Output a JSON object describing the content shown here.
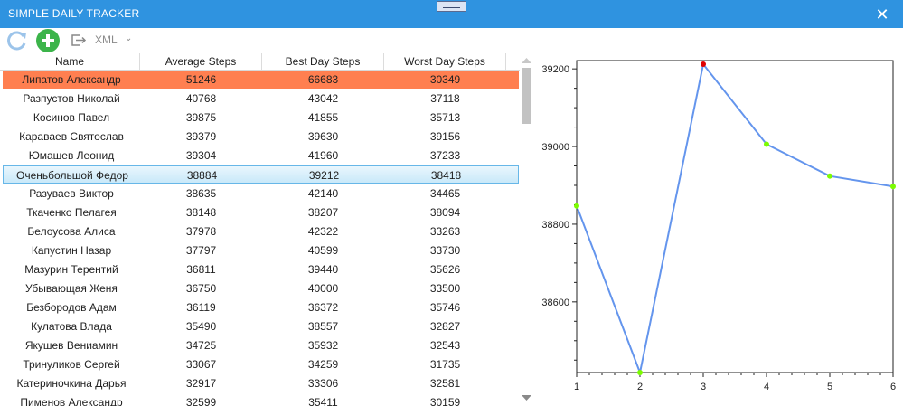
{
  "window": {
    "title": "SIMPLE DAILY TRACKER",
    "close_glyph": "✕"
  },
  "toolbar": {
    "refresh_icon": "refresh-icon",
    "add_icon": "add-icon",
    "export_icon": "export-icon",
    "format_label": "XML",
    "dropdown_glyph": "⌄"
  },
  "colors": {
    "titlebar": "#2f93e0",
    "selected_row": "#ff7f50",
    "line": "#6495ed",
    "point": "#7cfc00",
    "max_point": "#e00000"
  },
  "table": {
    "columns": [
      "Name",
      "Average Steps",
      "Best Day Steps",
      "Worst Day Steps"
    ],
    "rows": [
      [
        "Липатов Александр",
        "51246",
        "66683",
        "30349"
      ],
      [
        "Разпустов Николай",
        "40768",
        "43042",
        "37118"
      ],
      [
        "Косинов Павел",
        "39875",
        "41855",
        "35713"
      ],
      [
        "Караваев Святослав",
        "39379",
        "39630",
        "39156"
      ],
      [
        "Юмашев Леонид",
        "39304",
        "41960",
        "37233"
      ],
      [
        "Оченьбольшой Федор",
        "38884",
        "39212",
        "38418"
      ],
      [
        "Разуваев Виктор",
        "38635",
        "42140",
        "34465"
      ],
      [
        "Ткаченко Пелагея",
        "38148",
        "38207",
        "38094"
      ],
      [
        "Белоусова Алиса",
        "37978",
        "42322",
        "33263"
      ],
      [
        "Капустин Назар",
        "37797",
        "40599",
        "33730"
      ],
      [
        "Мазурин Терентий",
        "36811",
        "39440",
        "35626"
      ],
      [
        "Убывающая Женя",
        "36750",
        "40000",
        "33500"
      ],
      [
        "Безбородов Адам",
        "36119",
        "36372",
        "35746"
      ],
      [
        "Кулатова Влада",
        "35490",
        "38557",
        "32827"
      ],
      [
        "Якушев Вениамин",
        "34725",
        "35932",
        "32543"
      ],
      [
        "Тринуликов Сергей",
        "33067",
        "34259",
        "31735"
      ],
      [
        "Катериночкина Дарья",
        "32917",
        "33306",
        "32581"
      ],
      [
        "Пименов Александр",
        "32599",
        "35411",
        "30159"
      ]
    ],
    "selected_index": 0,
    "highlighted_index": 5
  },
  "chart_data": {
    "type": "line",
    "x": [
      1,
      2,
      3,
      4,
      5,
      6
    ],
    "values": [
      38847,
      38418,
      39212,
      39006,
      38924,
      38897
    ],
    "xlim": [
      1,
      6
    ],
    "ylim": [
      38418,
      39212
    ],
    "y_ticks": [
      38600,
      38800,
      39000,
      39200
    ],
    "x_ticks": [
      1,
      2,
      3,
      4,
      5,
      6
    ],
    "max_index": 2
  }
}
